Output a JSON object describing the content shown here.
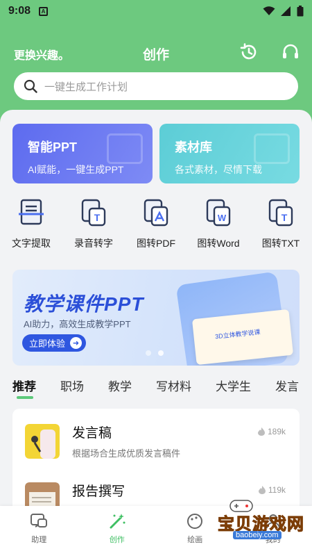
{
  "status": {
    "time": "9:08",
    "a_badge": "A"
  },
  "header": {
    "left_label": "更换兴趣。",
    "title": "创作",
    "history_icon": "history-icon",
    "support_icon": "headset-icon"
  },
  "search": {
    "placeholder": "一键生成工作计划",
    "icon": "search-icon"
  },
  "cards": [
    {
      "title": "智能PPT",
      "subtitle": "AI赋能，一键生成PPT",
      "color": "#5d6bef"
    },
    {
      "title": "素材库",
      "subtitle": "各式素材，尽情下载",
      "color": "#5ccdd6"
    }
  ],
  "tools": [
    {
      "label": "文字提取",
      "icon": "text-scan-icon"
    },
    {
      "label": "录音转字",
      "icon": "audio-to-text-icon"
    },
    {
      "label": "图转PDF",
      "icon": "image-to-pdf-icon"
    },
    {
      "label": "图转Word",
      "icon": "image-to-word-icon"
    },
    {
      "label": "图转TXT",
      "icon": "image-to-txt-icon"
    }
  ],
  "banner": {
    "title": "教学课件PPT",
    "subtitle": "AI助力，高效生成教学PPT",
    "button": "立即体验",
    "sheet_text": "3D立体教学说课",
    "active_dot": 1
  },
  "tabs": [
    "推荐",
    "职场",
    "教学",
    "写材料",
    "大学生",
    "发言"
  ],
  "active_tab": 0,
  "list": [
    {
      "title": "发言稿",
      "desc": "根据场合生成优质发言稿件",
      "count": "189k"
    },
    {
      "title": "报告撰写",
      "desc": "",
      "count": "119k"
    }
  ],
  "nav": [
    {
      "label": "助理",
      "icon": "chat-icon"
    },
    {
      "label": "创作",
      "icon": "magic-wand-icon"
    },
    {
      "label": "绘画",
      "icon": "paint-icon"
    },
    {
      "label": "我的",
      "icon": "profile-icon"
    }
  ],
  "watermark": {
    "text": "宝贝游戏网",
    "url": "baobeiy.com"
  },
  "colors": {
    "brand_green": "#6dc97f",
    "active_green": "#3fbf63",
    "banner_blue": "#2f57e0"
  }
}
